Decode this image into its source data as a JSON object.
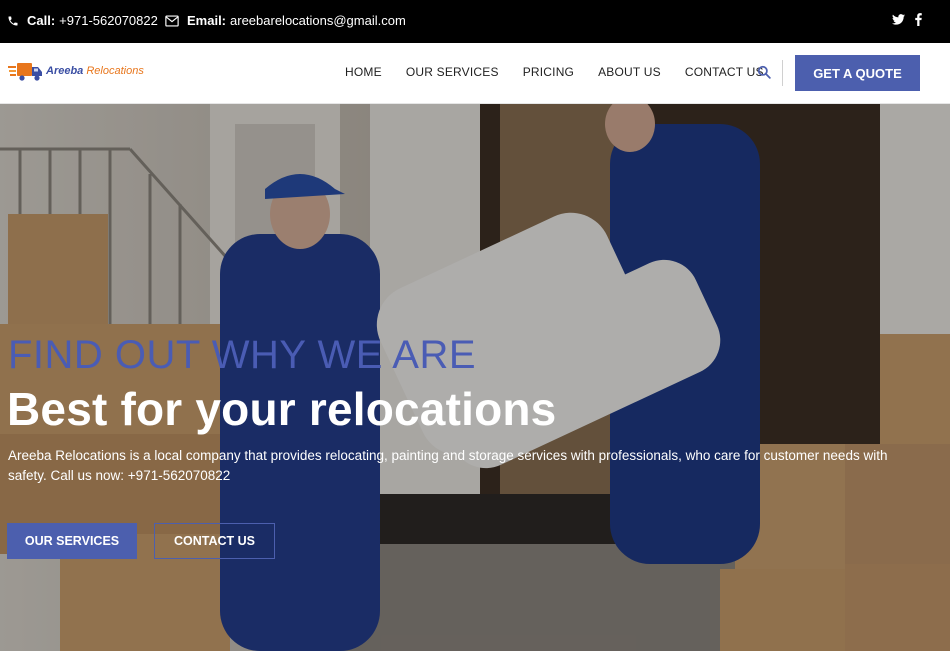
{
  "topbar": {
    "call_label": "Call:",
    "call_value": "+971-562070822",
    "email_label": "Email:",
    "email_value": "areebarelocations@gmail.com",
    "social": [
      "twitter-icon",
      "facebook-icon"
    ]
  },
  "header": {
    "logo": {
      "first": "Areeba",
      "second": "Relocations"
    },
    "nav": [
      "HOME",
      "OUR SERVICES",
      "PRICING",
      "ABOUT US",
      "CONTACT US"
    ],
    "quote_button": "GET A QUOTE"
  },
  "hero": {
    "kicker": "FIND OUT WHY WE ARE",
    "title": "Best for your relocations",
    "description": "Areeba Relocations is a local company that provides relocating, painting and storage services with professionals, who care for customer needs with safety. Call us now: +971-562070822",
    "primary_button": "OUR SERVICES",
    "secondary_button": "CONTACT US"
  },
  "colors": {
    "topbar_bg": "#000000",
    "accent": "#4c5fae",
    "logo_orange": "#e8761c"
  }
}
